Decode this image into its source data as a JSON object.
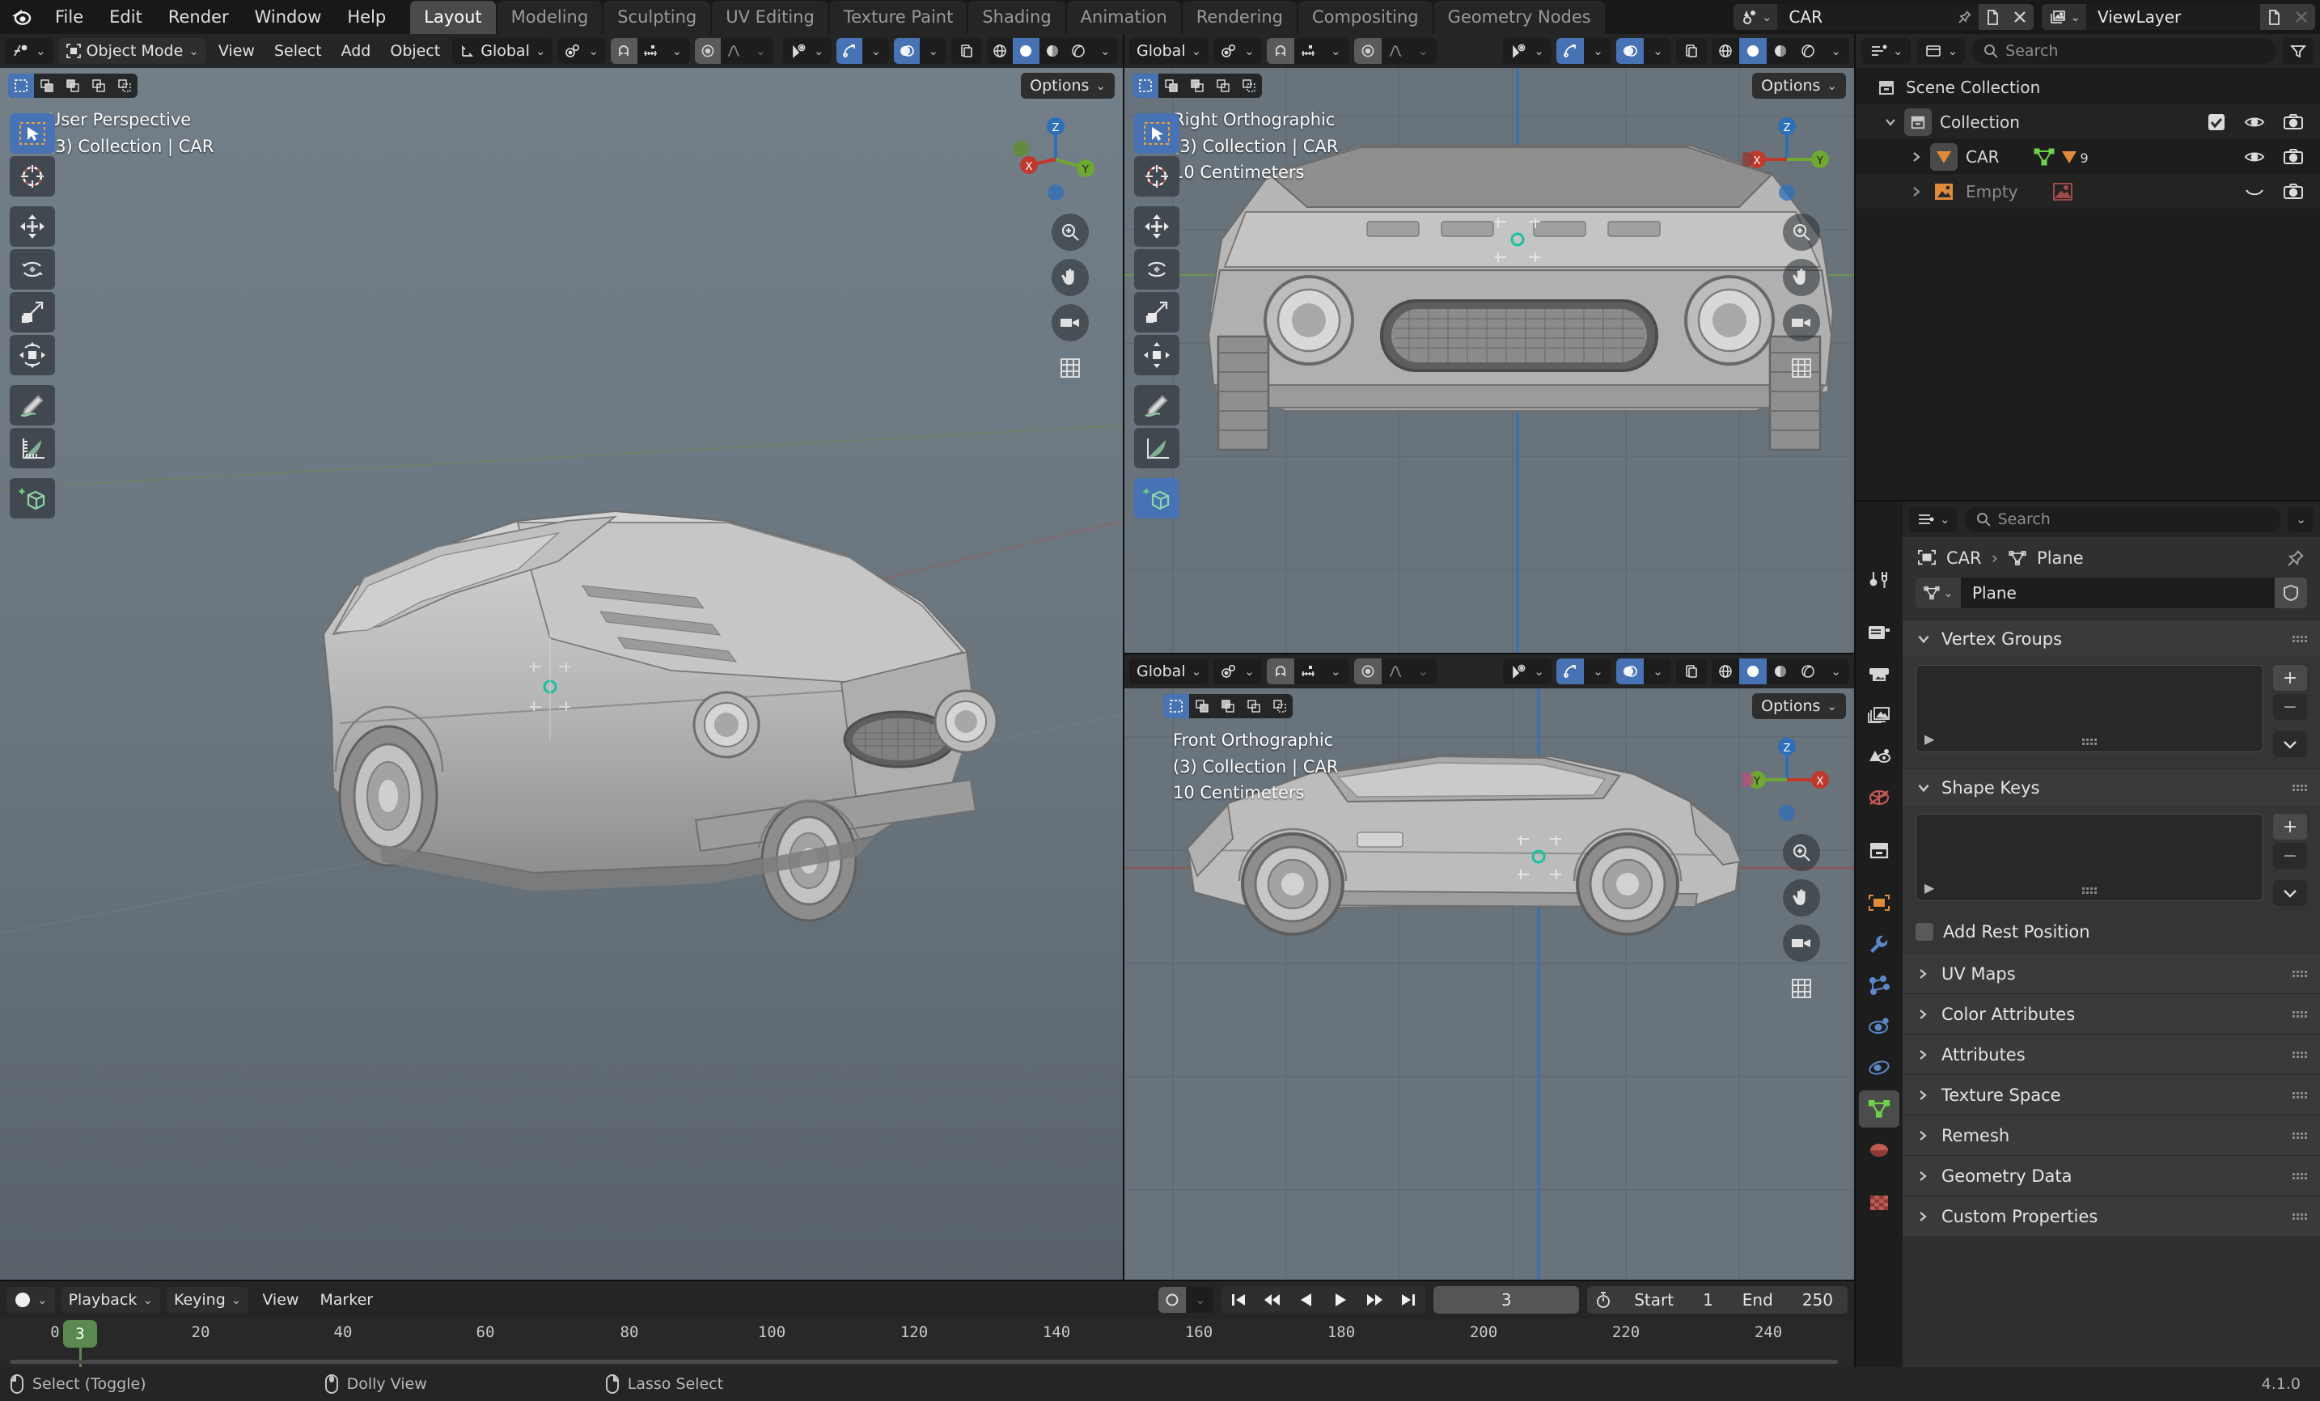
{
  "app": {
    "version": "4.1.0"
  },
  "topbar": {
    "menus": [
      "File",
      "Edit",
      "Render",
      "Window",
      "Help"
    ],
    "workspaces": [
      {
        "label": "Layout",
        "active": true
      },
      {
        "label": "Modeling",
        "active": false
      },
      {
        "label": "Sculpting",
        "active": false
      },
      {
        "label": "UV Editing",
        "active": false
      },
      {
        "label": "Texture Paint",
        "active": false
      },
      {
        "label": "Shading",
        "active": false
      },
      {
        "label": "Animation",
        "active": false
      },
      {
        "label": "Rendering",
        "active": false
      },
      {
        "label": "Compositing",
        "active": false
      },
      {
        "label": "Geometry Nodes",
        "active": false
      }
    ],
    "scene_name": "CAR",
    "viewlayer_name": "ViewLayer"
  },
  "viewport_header": {
    "mode": "Object Mode",
    "menus": [
      "View",
      "Select",
      "Add",
      "Object"
    ],
    "transform_orientation": "Global",
    "options_label": "Options"
  },
  "viewports": [
    {
      "id": "user-perspective",
      "view_name": "User Perspective",
      "collection_line": "(3) Collection | CAR",
      "scale_line": "",
      "options_label": "Options"
    },
    {
      "id": "right-orthographic",
      "view_name": "Right Orthographic",
      "collection_line": "(3) Collection | CAR",
      "scale_line": "10 Centimeters",
      "options_label": "Options",
      "transform_orientation": "Global"
    },
    {
      "id": "front-orthographic",
      "view_name": "Front Orthographic",
      "collection_line": "(3) Collection | CAR",
      "scale_line": "10 Centimeters",
      "options_label": "Options",
      "transform_orientation": "Global"
    }
  ],
  "toolbar_tools": [
    {
      "name": "tweak-select-box",
      "active": true
    },
    {
      "name": "cursor",
      "active": false
    },
    {
      "name": "move",
      "active": false
    },
    {
      "name": "rotate",
      "active": false
    },
    {
      "name": "scale",
      "active": false
    },
    {
      "name": "transform",
      "active": false
    },
    {
      "name": "annotate",
      "active": false
    },
    {
      "name": "measure",
      "active": false
    },
    {
      "name": "add-cube",
      "active": false
    }
  ],
  "outliner": {
    "search_placeholder": "Search",
    "rows": [
      {
        "label": "Scene Collection",
        "indent": 0,
        "icon": "collection-icon",
        "expandable": false,
        "checkbox": false,
        "eye": false,
        "camera": false
      },
      {
        "label": "Collection",
        "indent": 1,
        "icon": "collection-icon",
        "expandable": true,
        "expanded": true,
        "checkbox": true,
        "eye": true,
        "camera": true
      },
      {
        "label": "CAR",
        "indent": 2,
        "icon": "mesh-data-icon",
        "expandable": true,
        "expanded": false,
        "checkbox": false,
        "eye": true,
        "camera": true,
        "badge": "9"
      },
      {
        "label": "Empty",
        "indent": 2,
        "icon": "image-object-icon",
        "expandable": true,
        "expanded": false,
        "checkbox": false,
        "eye": false,
        "camera": true,
        "hidden": true
      }
    ]
  },
  "properties": {
    "search_placeholder": "Search",
    "breadcrumb": [
      "CAR",
      "Plane"
    ],
    "datablock_name": "Plane",
    "tabs": [
      {
        "name": "tool-tab",
        "icon": "tool-icon",
        "active": false
      },
      {
        "name": "render-tab",
        "icon": "camera-back-icon",
        "active": false
      },
      {
        "name": "output-tab",
        "icon": "printer-icon",
        "active": false
      },
      {
        "name": "view-layer-tab",
        "icon": "images-icon",
        "active": false
      },
      {
        "name": "scene-tab",
        "icon": "scene-cone-icon",
        "active": false
      },
      {
        "name": "world-tab",
        "icon": "world-icon",
        "active": false
      },
      {
        "name": "collection-tab",
        "icon": "collection-icon",
        "active": false
      },
      {
        "name": "object-tab",
        "icon": "object-square-icon",
        "active": false
      },
      {
        "name": "modifiers-tab",
        "icon": "wrench-icon",
        "active": false
      },
      {
        "name": "particles-tab",
        "icon": "particles-icon",
        "active": false
      },
      {
        "name": "physics-tab",
        "icon": "physics-orbit-icon",
        "active": false
      },
      {
        "name": "constraints-tab",
        "icon": "constraint-icon",
        "active": false
      },
      {
        "name": "data-tab",
        "icon": "mesh-data-icon",
        "active": true
      },
      {
        "name": "material-tab",
        "icon": "material-sphere-icon",
        "active": false
      },
      {
        "name": "texture-tab",
        "icon": "texture-checker-icon",
        "active": false
      }
    ],
    "panels": [
      {
        "label": "Vertex Groups",
        "open": true,
        "type": "list"
      },
      {
        "label": "Shape Keys",
        "open": true,
        "type": "list",
        "extra_checkbox": "Add Rest Position"
      },
      {
        "label": "UV Maps",
        "open": false
      },
      {
        "label": "Color Attributes",
        "open": false
      },
      {
        "label": "Attributes",
        "open": false
      },
      {
        "label": "Texture Space",
        "open": false
      },
      {
        "label": "Remesh",
        "open": false
      },
      {
        "label": "Geometry Data",
        "open": false
      },
      {
        "label": "Custom Properties",
        "open": false
      }
    ]
  },
  "timeline": {
    "menus": [
      "Playback",
      "Keying",
      "View",
      "Marker"
    ],
    "current_frame": "3",
    "start_label": "Start",
    "start_value": "1",
    "end_label": "End",
    "end_value": "250",
    "ticks": [
      "0",
      "20",
      "40",
      "60",
      "80",
      "100",
      "120",
      "140",
      "160",
      "180",
      "200",
      "220",
      "240"
    ]
  },
  "status_bar": {
    "items": [
      {
        "icon": "mouse-left-icon",
        "label": "Select (Toggle)"
      },
      {
        "icon": "mouse-middle-icon",
        "label": "Dolly View"
      },
      {
        "icon": "mouse-right-icon",
        "label": "Lasso Select"
      }
    ]
  },
  "colors": {
    "accent_blue": "#4772b3",
    "header_bg": "#252525",
    "panel_bg": "#303030",
    "viewport_bg": "#6b767f",
    "playhead_green": "#5a8a4f",
    "axis_x": "#c0392b",
    "axis_y": "#6ea832",
    "axis_z": "#2d6fb8",
    "mesh_orange": "#e08b3a",
    "mesh_green": "#6fd04a"
  }
}
